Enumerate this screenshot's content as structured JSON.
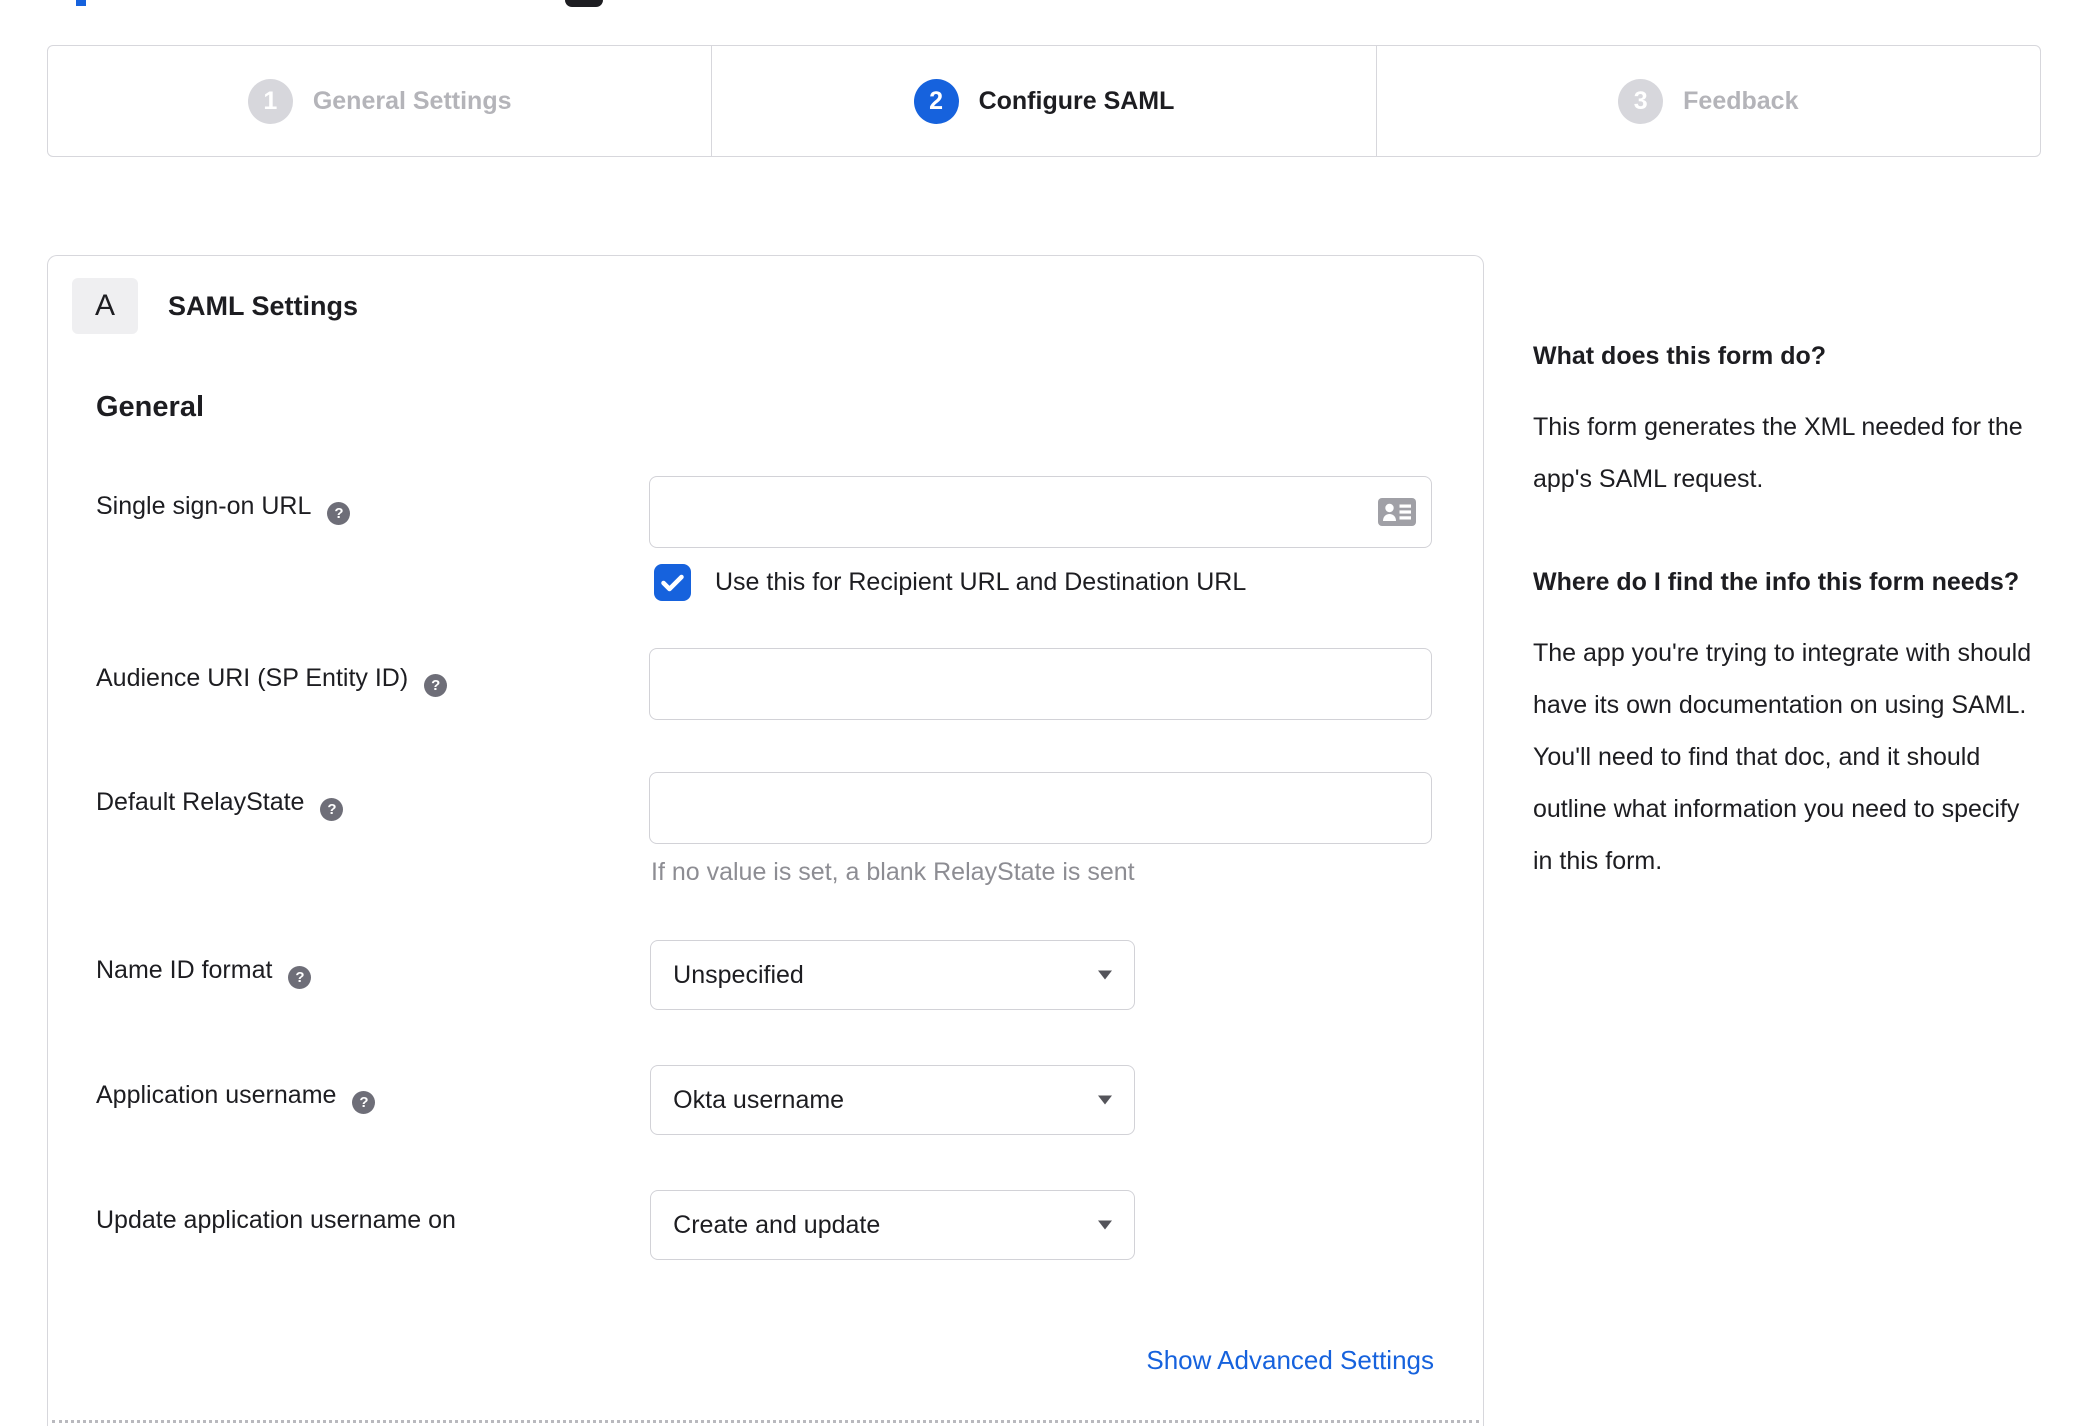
{
  "colors": {
    "accent_blue": "#1662dd",
    "inactive_gray": "#d7d7dc",
    "text_dark": "#1d1d21",
    "hint_gray": "#8d8d93"
  },
  "stepper": {
    "active_step": 2,
    "steps": [
      {
        "number": "1",
        "label": "General Settings"
      },
      {
        "number": "2",
        "label": "Configure SAML"
      },
      {
        "number": "3",
        "label": "Feedback"
      }
    ]
  },
  "panel": {
    "badge": "A",
    "title": "SAML Settings",
    "group_heading": "General"
  },
  "form": {
    "rows": [
      {
        "label": "Single sign-on URL",
        "value": "",
        "checkbox_checked": true,
        "checkbox_label": "Use this for Recipient URL and Destination URL"
      },
      {
        "label": "Audience URI (SP Entity ID)",
        "value": ""
      },
      {
        "label": "Default RelayState",
        "value": "",
        "hint": "If no value is set, a blank RelayState is sent"
      },
      {
        "label": "Name ID format",
        "value": "Unspecified"
      },
      {
        "label": "Application username",
        "value": "Okta username"
      },
      {
        "label": "Update application username on",
        "value": "Create and update"
      }
    ],
    "advanced_link": "Show Advanced Settings"
  },
  "sidebar": {
    "sections": [
      {
        "heading": "What does this form do?",
        "body": "This form generates the XML needed for the app's SAML request."
      },
      {
        "heading": "Where do I find the info this form needs?",
        "body": "The app you're trying to integrate with should have its own documentation on using SAML. You'll need to find that doc, and it should outline what information you need to specify in this form."
      }
    ]
  },
  "icons": {
    "help": "?"
  }
}
